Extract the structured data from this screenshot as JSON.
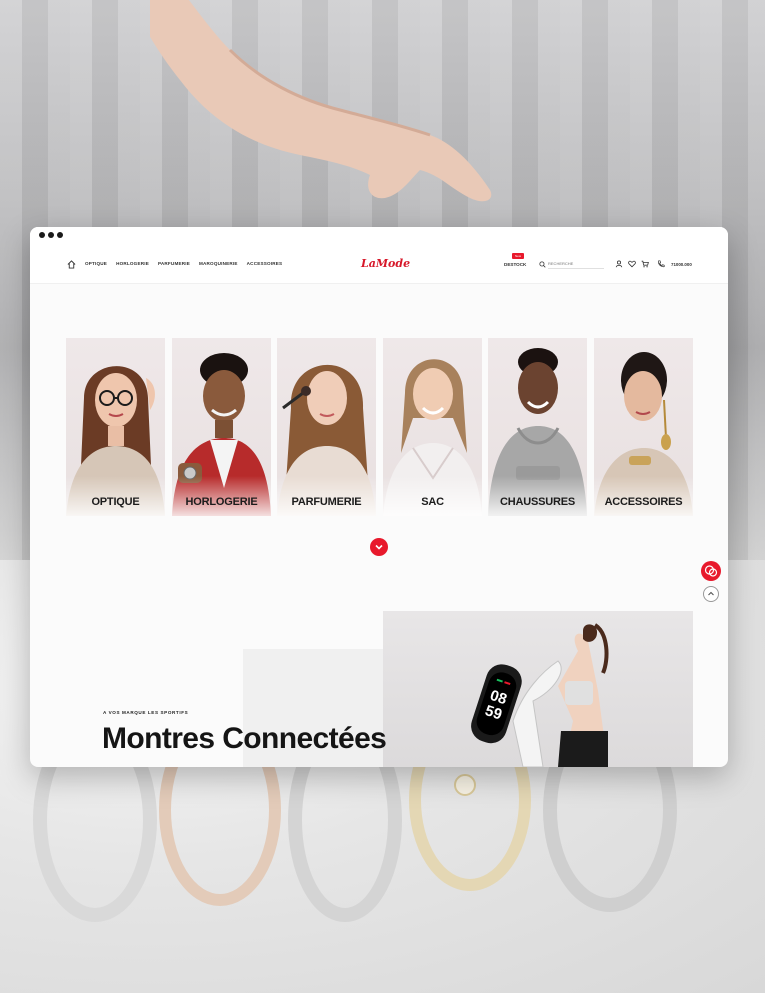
{
  "brand": {
    "logo_text": "LaMode",
    "accent_color": "#e8192c"
  },
  "header": {
    "nav": [
      {
        "label": "OPTIQUE"
      },
      {
        "label": "HORLOGERIE"
      },
      {
        "label": "PARFUMERIE"
      },
      {
        "label": "MAROQUINERIE"
      },
      {
        "label": "ACCESSOIRES"
      }
    ],
    "destock_label": "DESTOCK",
    "new_badge": "New",
    "search_placeholder": "RECHERCHE",
    "phone": "71000.000",
    "icons": [
      "home-icon",
      "search-icon",
      "user-icon",
      "heart-icon",
      "cart-icon",
      "phone-icon"
    ]
  },
  "categories": [
    {
      "label": "OPTIQUE"
    },
    {
      "label": "HORLOGERIE"
    },
    {
      "label": "PARFUMERIE"
    },
    {
      "label": "SAC"
    },
    {
      "label": "CHAUSSURES"
    },
    {
      "label": "ACCESSOIRES"
    }
  ],
  "promo": {
    "eyebrow": "A VOS MARQUE LES SPORTIFS",
    "title": "Montres Connectées",
    "watch_time_top": "08",
    "watch_time_bottom": "59"
  },
  "floating": {
    "chat_icon": "chat-icon",
    "top_icon": "chevron-up-icon",
    "scroll_icon": "chevron-down-icon"
  }
}
